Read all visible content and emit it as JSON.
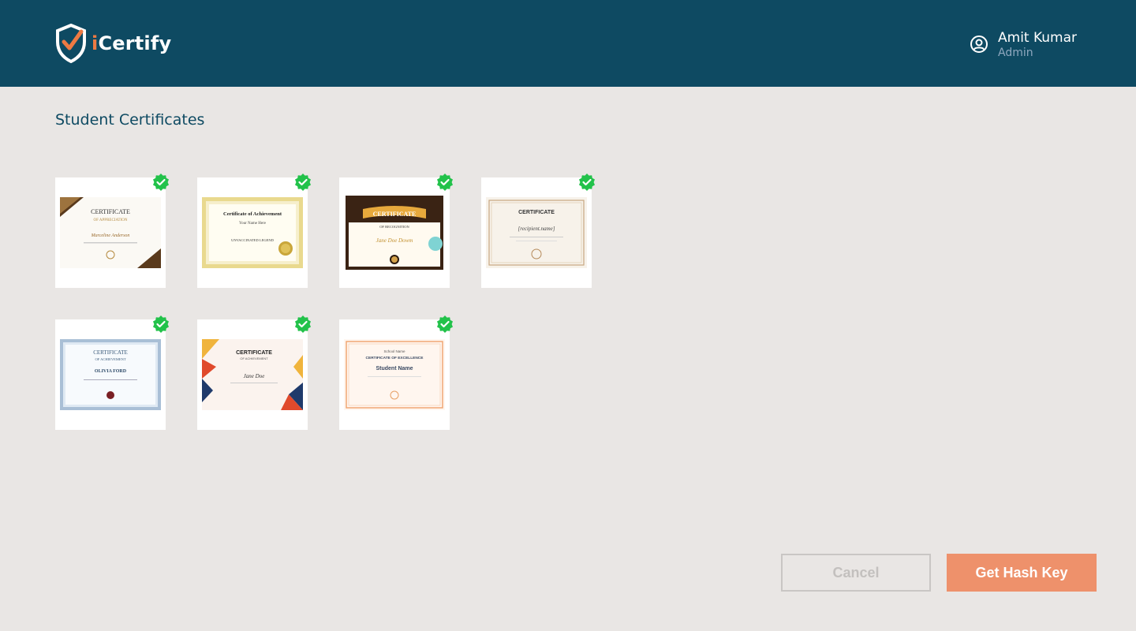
{
  "header": {
    "brand_i": "i",
    "brand_rest": "Certify",
    "user_name": "Amit Kumar",
    "user_role": "Admin"
  },
  "main": {
    "title": "Student Certificates",
    "certificates": [
      {
        "line1": "CERTIFICATE",
        "line2": "OF APPRECIATION",
        "name": "Marceline Anderson",
        "verified": true
      },
      {
        "line1": "Certificate of Achievement",
        "line2": "Your Name Here",
        "name": "UNVACCINATED LEGEND",
        "verified": true
      },
      {
        "line1": "CERTIFICATE",
        "line2": "OF RECOGNITION",
        "name": "Jane Doe Dowm",
        "verified": true
      },
      {
        "line1": "CERTIFICATE",
        "line2": "",
        "name": "[recipient.name]",
        "verified": true
      },
      {
        "line1": "CERTIFICATE",
        "line2": "OF ACHIEVEMENT",
        "name": "OLIVIA FORD",
        "verified": true
      },
      {
        "line1": "CERTIFICATE",
        "line2": "OF ACHIEVEMENT",
        "name": "Jane Doe",
        "verified": true
      },
      {
        "line1": "CERTIFICATE OF EXCELLENCE",
        "line2": "School Name",
        "name": "Student Name",
        "verified": true
      }
    ]
  },
  "actions": {
    "cancel_label": "Cancel",
    "hash_label": "Get Hash Key"
  },
  "colors": {
    "header_bg": "#0e4a62",
    "accent": "#ee916b",
    "verified": "#22c24a"
  }
}
